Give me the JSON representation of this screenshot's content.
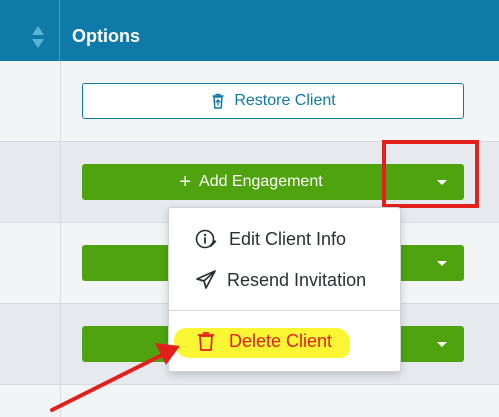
{
  "header": {
    "title": "Options",
    "sort_icon": "sort-icon"
  },
  "restore_button": {
    "label": "Restore Client",
    "icon": "trash-restore-icon"
  },
  "green_buttons": [
    {
      "label": "Add Engagement",
      "icon": "plus-icon"
    },
    {
      "label": ""
    },
    {
      "label": ""
    }
  ],
  "dropdown": {
    "items": [
      {
        "label": "Edit Client Info",
        "icon": "info-edit-icon"
      },
      {
        "label": "Resend Invitation",
        "icon": "send-icon"
      },
      {
        "label": "Delete Client",
        "icon": "trash-icon",
        "color": "#e3201b"
      }
    ]
  },
  "colors": {
    "header": "#0f7aa7",
    "primary_green": "#4ea30e",
    "danger": "#e3201b",
    "highlight": "#f9f51e",
    "annotation": "#e3201b"
  }
}
